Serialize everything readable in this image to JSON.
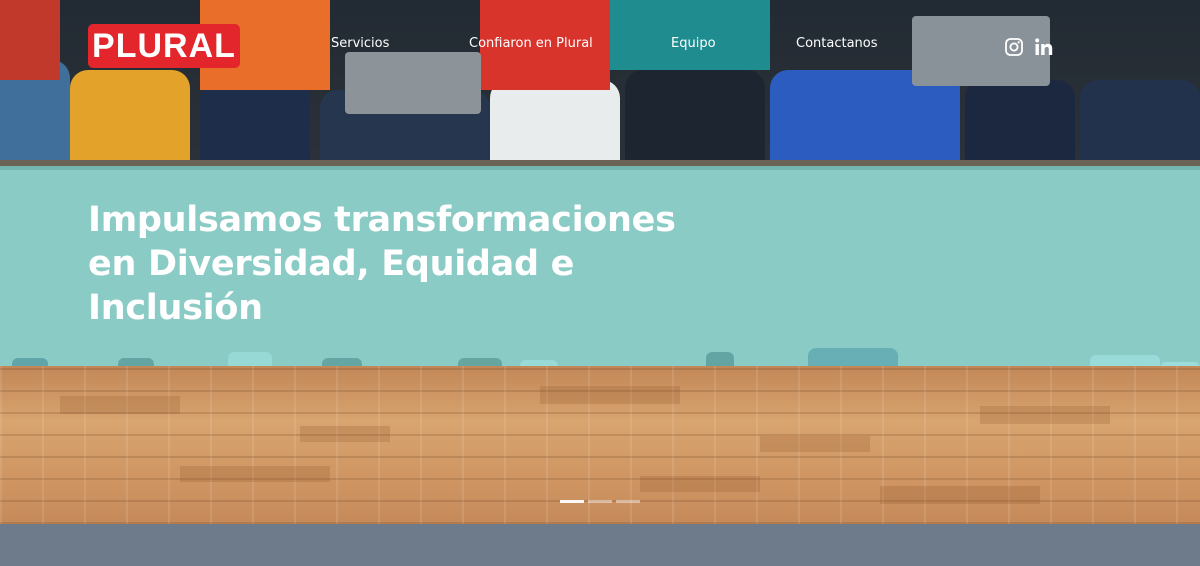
{
  "brand": {
    "logo_text": "PLURAL",
    "logo_color": "#e3262b"
  },
  "nav": {
    "items": [
      {
        "label": "Servicios"
      },
      {
        "label": "Confiaron en Plural"
      },
      {
        "label": "Equipo"
      },
      {
        "label": "Contactanos"
      }
    ]
  },
  "social": {
    "icons": [
      "instagram-icon",
      "linkedin-icon"
    ]
  },
  "hero": {
    "headline_line1": "Impulsamos transformaciones",
    "headline_line2": "en Diversidad, Equidad e",
    "headline_line3": "Inclusión",
    "overlay_color": "#78d6d2"
  },
  "carousel": {
    "slide_count": 3,
    "active_index": 0
  },
  "colors": {
    "accent": "#e3262b",
    "footer_bar": "#6d7b8b"
  }
}
